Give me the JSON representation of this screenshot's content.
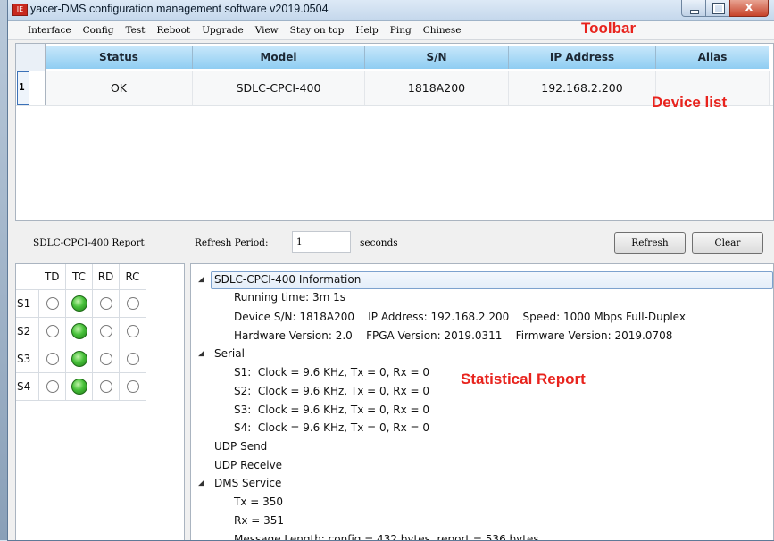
{
  "window": {
    "title": "yacer-DMS configuration management software v2019.0504",
    "icon_text": "IE",
    "close_glyph": "x"
  },
  "menu": [
    "Interface",
    "Config",
    "Test",
    "Reboot",
    "Upgrade",
    "View",
    "Stay on top",
    "Help",
    "Ping",
    "Chinese"
  ],
  "annotations": {
    "toolbar": "Toolbar",
    "device_list": "Device list",
    "statistical_report": "Statistical Report"
  },
  "device_table": {
    "columns": [
      "Status",
      "Model",
      "S/N",
      "IP Address",
      "Alias"
    ],
    "rows": [
      {
        "num": "1",
        "status": "OK",
        "model": "SDLC-CPCI-400",
        "sn": "1818A200",
        "ip": "192.168.2.200",
        "alias": ""
      }
    ]
  },
  "report_bar": {
    "label": "SDLC-CPCI-400 Report",
    "refresh_period_label": "Refresh Period:",
    "refresh_period_value": "1",
    "seconds_label": "seconds",
    "refresh_button": "Refresh",
    "clear_button": "Clear"
  },
  "indicators": {
    "columns": [
      "TD",
      "TC",
      "RD",
      "RC"
    ],
    "rows": [
      {
        "label": "S1",
        "states": [
          false,
          true,
          false,
          false
        ]
      },
      {
        "label": "S2",
        "states": [
          false,
          true,
          false,
          false
        ]
      },
      {
        "label": "S3",
        "states": [
          false,
          true,
          false,
          false
        ]
      },
      {
        "label": "S4",
        "states": [
          false,
          true,
          false,
          false
        ]
      }
    ],
    "on_color": "#47c13a"
  },
  "report": {
    "info_header": "SDLC-CPCI-400 Information",
    "running_time": "Running time: 3m 1s",
    "device_line": "Device S/N: 1818A200    IP Address: 192.168.2.200    Speed: 1000 Mbps Full-Duplex",
    "hardware_line": "Hardware Version: 2.0    FPGA Version: 2019.0311    Firmware Version: 2019.0708",
    "serial_header": "Serial",
    "serial_lines": [
      "S1:  Clock = 9.6 KHz, Tx = 0, Rx = 0",
      "S2:  Clock = 9.6 KHz, Tx = 0, Rx = 0",
      "S3:  Clock = 9.6 KHz, Tx = 0, Rx = 0",
      "S4:  Clock = 9.6 KHz, Tx = 0, Rx = 0"
    ],
    "udp_send": "UDP Send",
    "udp_receive": "UDP Receive",
    "dms_header": "DMS Service",
    "dms_tx": "Tx = 350",
    "dms_rx": "Rx = 351",
    "message_length": "Message Length: config = 432 bytes, report = 536 bytes"
  },
  "colors": {
    "annotation_red": "#e8231d",
    "header_blue": "#8fcdf2"
  }
}
